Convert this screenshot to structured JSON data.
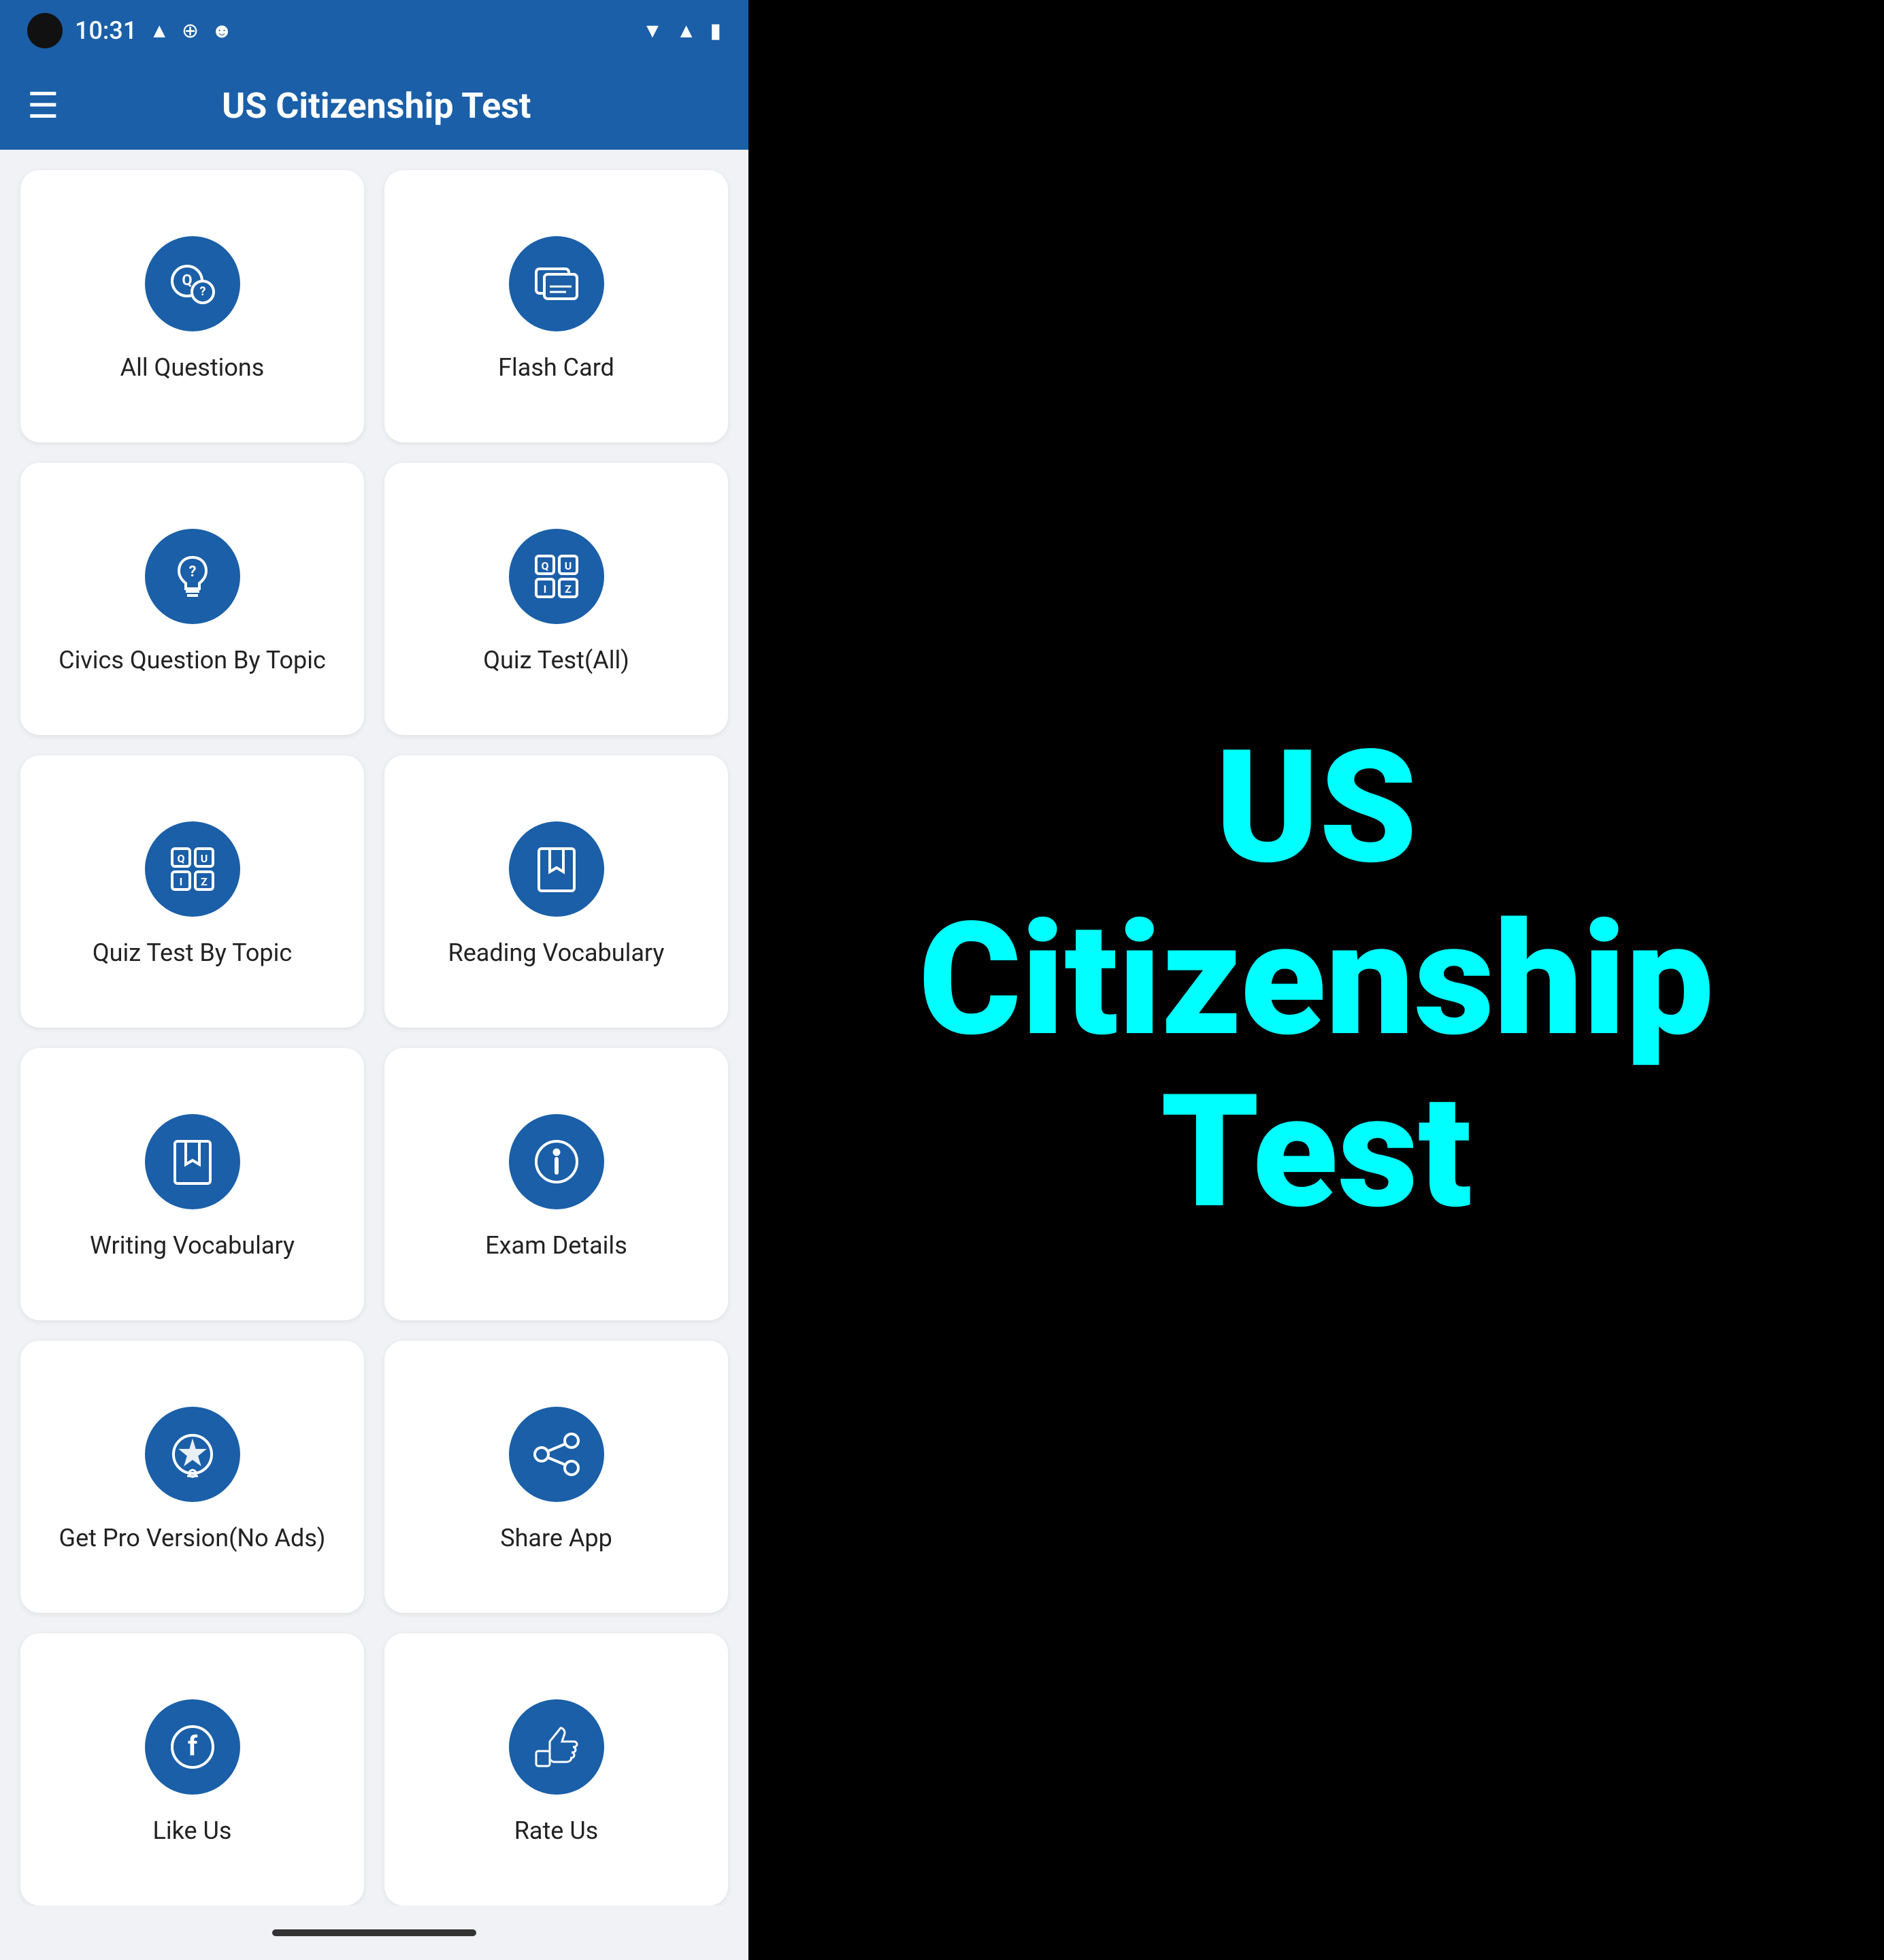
{
  "statusBar": {
    "time": "10:31"
  },
  "appBar": {
    "title": "US Citizenship Test"
  },
  "gridItems": [
    {
      "id": "all-questions",
      "label": "All Questions",
      "icon": "chat-question"
    },
    {
      "id": "flash-card",
      "label": "Flash Card",
      "icon": "flash-card"
    },
    {
      "id": "civics-question-by-topic",
      "label": "Civics Question By Topic",
      "icon": "lightbulb-question"
    },
    {
      "id": "quiz-test-all",
      "label": "Quiz Test(All)",
      "icon": "quiz-grid"
    },
    {
      "id": "quiz-test-by-topic",
      "label": "Quiz Test By Topic",
      "icon": "quiz-grid"
    },
    {
      "id": "reading-vocabulary",
      "label": "Reading Vocabulary",
      "icon": "bookmark-book"
    },
    {
      "id": "writing-vocabulary",
      "label": "Writing Vocabulary",
      "icon": "bookmark-book"
    },
    {
      "id": "exam-details",
      "label": "Exam Details",
      "icon": "info-circle"
    },
    {
      "id": "get-pro-version",
      "label": "Get Pro Version(No Ads)",
      "icon": "star-badge"
    },
    {
      "id": "share-app",
      "label": "Share App",
      "icon": "share"
    },
    {
      "id": "facebook",
      "label": "Like Us",
      "icon": "facebook"
    },
    {
      "id": "rate-us",
      "label": "Rate Us",
      "icon": "thumbs-up"
    }
  ],
  "bigTitle": "US Citizenship Test"
}
